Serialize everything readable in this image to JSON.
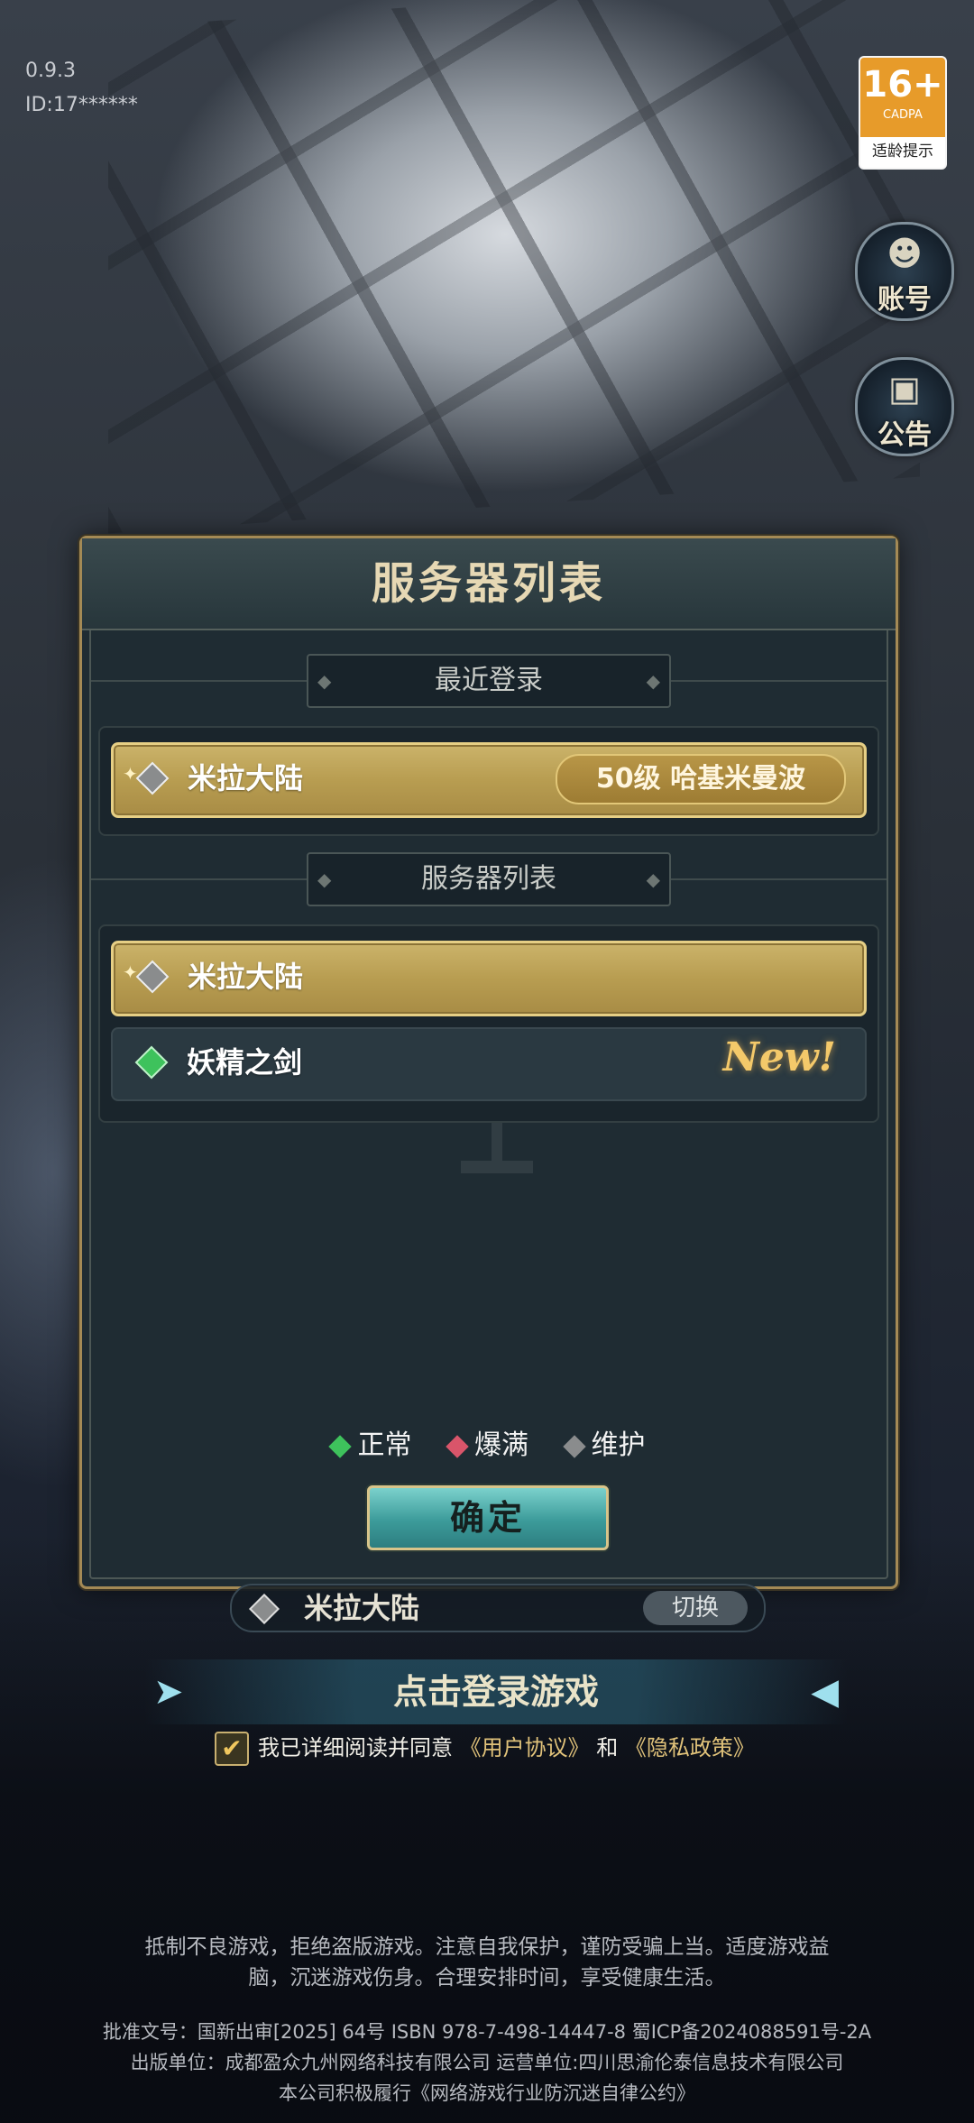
{
  "version": "0.9.3",
  "user_id": "ID:17******",
  "age_rating": {
    "number": "16+",
    "org": "CADPA",
    "label": "适龄提示"
  },
  "side_buttons": {
    "account": "账号",
    "notice": "公告"
  },
  "dialog": {
    "title": "服务器列表",
    "recent_header": "最近登录",
    "recent": {
      "server": "米拉大陆",
      "character": "50级 哈基米曼波"
    },
    "list_header": "服务器列表",
    "servers": [
      {
        "name": "米拉大陆",
        "status": "maintenance",
        "selected": true,
        "badge": ""
      },
      {
        "name": "妖精之剑",
        "status": "normal",
        "selected": false,
        "badge": "New!"
      }
    ],
    "legend": [
      {
        "label": "正常",
        "color": "#3ec25c"
      },
      {
        "label": "爆满",
        "color": "#d9556a"
      },
      {
        "label": "维护",
        "color": "#8a8c8d"
      }
    ],
    "confirm": "确定"
  },
  "current_server": {
    "name": "米拉大陆",
    "switch": "切换"
  },
  "login_button": "点击登录游戏",
  "agreement": {
    "prefix": "我已详细阅读并同意",
    "user_agreement": "《用户协议》",
    "and": "和",
    "privacy": "《隐私政策》"
  },
  "notice": {
    "line1": "抵制不良游戏，拒绝盗版游戏。注意自我保护，谨防受骗上当。适度游戏益",
    "line2": "脑，沉迷游戏伤身。合理安排时间，享受健康生活。",
    "line3": "批准文号：国新出审[2025] 64号 ISBN 978-7-498-14447-8 蜀ICP备2024088591号-2A",
    "line4": "出版单位：成都盈众九州网络科技有限公司 运营单位:四川思渝伦泰信息技术有限公司",
    "line5": "本公司积极履行《网络游戏行业防沉迷自律公约》"
  }
}
